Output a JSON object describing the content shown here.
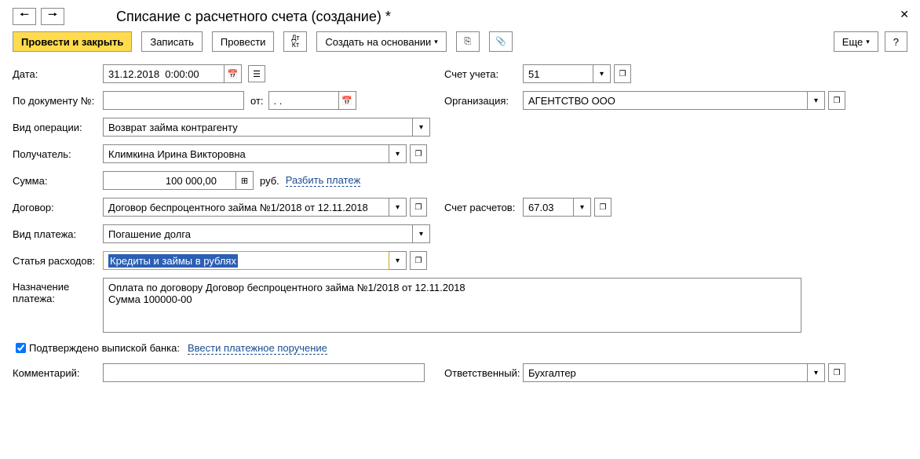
{
  "header": {
    "title": "Списание с расчетного счета (создание) *"
  },
  "toolbar": {
    "post_close": "Провести и закрыть",
    "write": "Записать",
    "post": "Провести",
    "dtkt": "Дт\nКт",
    "create_based": "Создать на основании",
    "more": "Еще",
    "help": "?"
  },
  "labels": {
    "date": "Дата:",
    "docnum": "По документу №:",
    "from": "от:",
    "operation": "Вид операции:",
    "recipient": "Получатель:",
    "sum": "Сумма:",
    "rub": "руб.",
    "split": "Разбить платеж",
    "contract": "Договор:",
    "pay_type": "Вид платежа:",
    "expense_item": "Статья расходов:",
    "purpose": "Назначение платежа:",
    "confirmed": "Подтверждено выпиской банка:",
    "enter_pay_order": "Ввести платежное поручение",
    "comment": "Комментарий:",
    "account": "Счет учета:",
    "organization": "Организация:",
    "settlement_acc": "Счет расчетов:",
    "responsible": "Ответственный:"
  },
  "values": {
    "date": "31.12.2018  0:00:00",
    "docnum": "",
    "docdate": ". .",
    "operation": "Возврат займа контрагенту",
    "recipient": "Климкина Ирина Викторовна",
    "sum": "100 000,00",
    "contract": "Договор беспроцентного займа №1/2018 от 12.11.2018",
    "pay_type": "Погашение долга",
    "expense_item": "Кредиты и займы в рублях",
    "purpose": "Оплата по договору Договор беспроцентного займа №1/2018 от 12.11.2018\nСумма 100000-00",
    "comment": "",
    "account": "51",
    "organization": "АГЕНТСТВО ООО",
    "settlement_acc": "67.03",
    "responsible": "Бухгалтер",
    "confirmed_checked": true
  }
}
